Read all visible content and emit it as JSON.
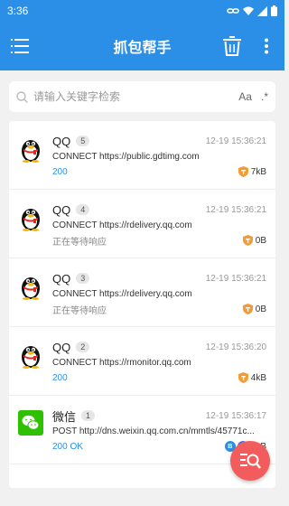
{
  "status_bar": {
    "time": "3:36"
  },
  "app_bar": {
    "title": "抓包帮手"
  },
  "search": {
    "placeholder": "请输入关键字检索",
    "case_toggle": "Aa",
    "regex_toggle": ".*"
  },
  "colors": {
    "primary": "#2b8fe8",
    "fab": "#f25c5c",
    "ok_status": "#2b8fe8",
    "shield": "#f39c34"
  },
  "requests": [
    {
      "app": "QQ",
      "icon": "qq-penguin-icon",
      "count": "5",
      "time": "12-19 15:36:21",
      "url": "CONNECT https://public.gdtimg.com",
      "status": "200",
      "status_kind": "ok",
      "size": "7kB",
      "badges": [
        "shield-icon"
      ]
    },
    {
      "app": "QQ",
      "icon": "qq-penguin-icon",
      "count": "4",
      "time": "12-19 15:36:21",
      "url": "CONNECT https://rdelivery.qq.com",
      "status": "正在等待响应",
      "status_kind": "wait",
      "size": "0B",
      "badges": [
        "shield-icon"
      ]
    },
    {
      "app": "QQ",
      "icon": "qq-penguin-icon",
      "count": "3",
      "time": "12-19 15:36:21",
      "url": "CONNECT https://rdelivery.qq.com",
      "status": "正在等待响应",
      "status_kind": "wait",
      "size": "0B",
      "badges": [
        "shield-icon"
      ]
    },
    {
      "app": "QQ",
      "icon": "qq-penguin-icon",
      "count": "2",
      "time": "12-19 15:36:20",
      "url": "CONNECT https://rmonitor.qq.com",
      "status": "200",
      "status_kind": "ok",
      "size": "4kB",
      "badges": [
        "shield-icon"
      ]
    },
    {
      "app": "微信",
      "icon": "wechat-icon",
      "count": "1",
      "time": "12-19 15:36:17",
      "url": "POST http://dns.weixin.qq.com.cn/mmtls/45771c...",
      "status": "200 OK",
      "status_kind": "ok",
      "size": "6kB",
      "badges": [
        "b-badge-icon",
        "h-badge-icon"
      ]
    }
  ]
}
